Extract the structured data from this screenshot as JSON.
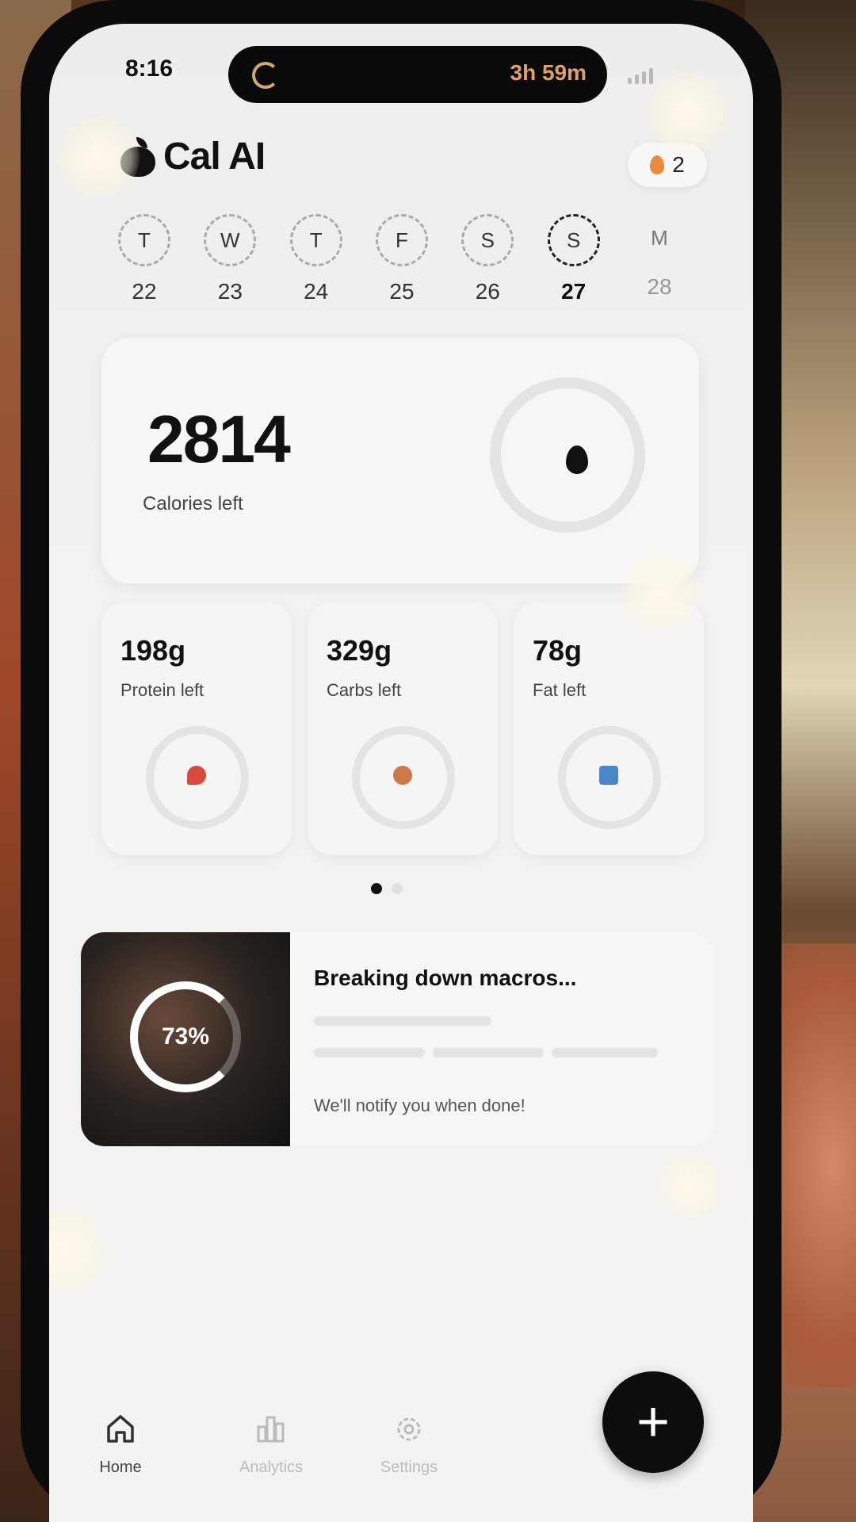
{
  "status": {
    "time": "8:16",
    "timer": "3h 59m"
  },
  "header": {
    "app_name": "Cal AI",
    "streak": "2"
  },
  "week": [
    {
      "letter": "T",
      "num": "22"
    },
    {
      "letter": "W",
      "num": "23"
    },
    {
      "letter": "T",
      "num": "24"
    },
    {
      "letter": "F",
      "num": "25"
    },
    {
      "letter": "S",
      "num": "26"
    },
    {
      "letter": "S",
      "num": "27"
    },
    {
      "letter": "M",
      "num": "28"
    }
  ],
  "calories": {
    "value": "2814",
    "label": "Calories left"
  },
  "macros": [
    {
      "value": "198g",
      "label": "Protein left"
    },
    {
      "value": "329g",
      "label": "Carbs left"
    },
    {
      "value": "78g",
      "label": "Fat left"
    }
  ],
  "processing": {
    "percent": "73%",
    "title": "Breaking down macros...",
    "note": "We'll notify you when done!"
  },
  "nav": {
    "home": "Home",
    "analytics": "Analytics",
    "settings": "Settings"
  }
}
